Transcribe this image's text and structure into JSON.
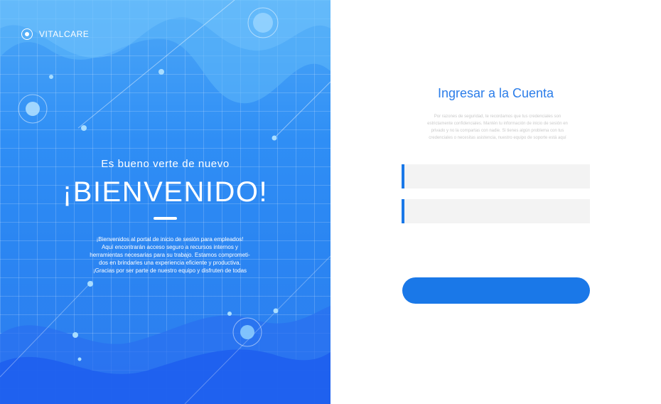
{
  "brand": {
    "name": "VITALCARE",
    "icon": "target-circle-icon"
  },
  "hero": {
    "subtitle": "Es bueno verte de nuevo",
    "title": "¡BIENVENIDO!",
    "paragraph_lines": [
      "¡Bienvenidos al portal de inicio de sesión para empleados!",
      "Aquí encontrarán acceso seguro a recursos internos y",
      "herramientas necesarias para su trabajo. Estamos comprometi-",
      "dos en brindarles una experiencia eficiente y productiva.",
      "¡Gracias por ser parte de nuestro equipo y disfruten de todas"
    ]
  },
  "login": {
    "title": "Ingresar a la Cuenta",
    "note_lines": [
      "Por razones de seguridad, te recordamos que tus credenciales son",
      "estrictamente confidenciales. Mantén tu información de inicio de sesión en",
      "privado y no la compartas con nadie. Si tienes algún problema con tus",
      "credenciales o necesitas asistencia, nuestro equipo de soporte está aquí"
    ],
    "username_value": "",
    "password_value": "",
    "button_label": ""
  },
  "colors": {
    "accent": "#1a78e8",
    "title_blue": "#2b7de9",
    "panel_blue": "#2f8ef5"
  }
}
